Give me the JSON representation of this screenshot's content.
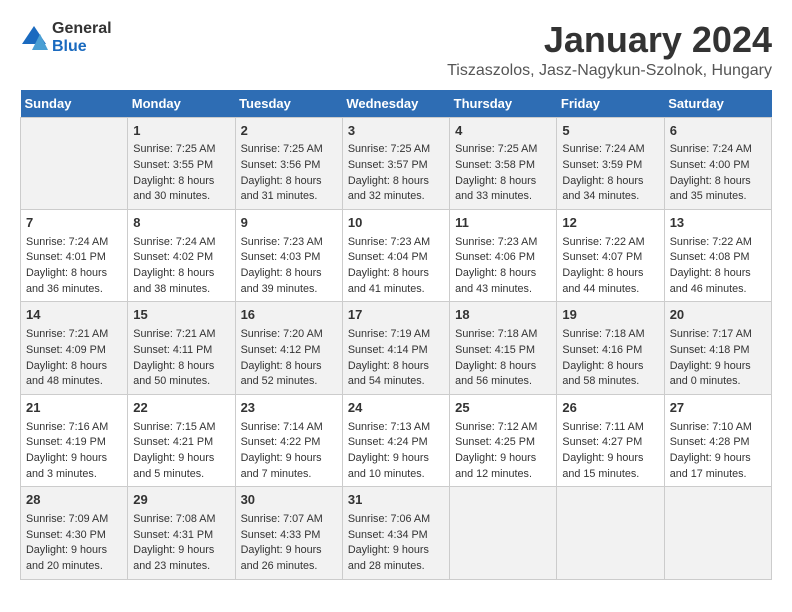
{
  "logo": {
    "general": "General",
    "blue": "Blue"
  },
  "header": {
    "title": "January 2024",
    "subtitle": "Tiszaszolos, Jasz-Nagykun-Szolnok, Hungary"
  },
  "days_of_week": [
    "Sunday",
    "Monday",
    "Tuesday",
    "Wednesday",
    "Thursday",
    "Friday",
    "Saturday"
  ],
  "weeks": [
    [
      {
        "day": "",
        "info": ""
      },
      {
        "day": "1",
        "info": "Sunrise: 7:25 AM\nSunset: 3:55 PM\nDaylight: 8 hours\nand 30 minutes."
      },
      {
        "day": "2",
        "info": "Sunrise: 7:25 AM\nSunset: 3:56 PM\nDaylight: 8 hours\nand 31 minutes."
      },
      {
        "day": "3",
        "info": "Sunrise: 7:25 AM\nSunset: 3:57 PM\nDaylight: 8 hours\nand 32 minutes."
      },
      {
        "day": "4",
        "info": "Sunrise: 7:25 AM\nSunset: 3:58 PM\nDaylight: 8 hours\nand 33 minutes."
      },
      {
        "day": "5",
        "info": "Sunrise: 7:24 AM\nSunset: 3:59 PM\nDaylight: 8 hours\nand 34 minutes."
      },
      {
        "day": "6",
        "info": "Sunrise: 7:24 AM\nSunset: 4:00 PM\nDaylight: 8 hours\nand 35 minutes."
      }
    ],
    [
      {
        "day": "7",
        "info": "Sunrise: 7:24 AM\nSunset: 4:01 PM\nDaylight: 8 hours\nand 36 minutes."
      },
      {
        "day": "8",
        "info": "Sunrise: 7:24 AM\nSunset: 4:02 PM\nDaylight: 8 hours\nand 38 minutes."
      },
      {
        "day": "9",
        "info": "Sunrise: 7:23 AM\nSunset: 4:03 PM\nDaylight: 8 hours\nand 39 minutes."
      },
      {
        "day": "10",
        "info": "Sunrise: 7:23 AM\nSunset: 4:04 PM\nDaylight: 8 hours\nand 41 minutes."
      },
      {
        "day": "11",
        "info": "Sunrise: 7:23 AM\nSunset: 4:06 PM\nDaylight: 8 hours\nand 43 minutes."
      },
      {
        "day": "12",
        "info": "Sunrise: 7:22 AM\nSunset: 4:07 PM\nDaylight: 8 hours\nand 44 minutes."
      },
      {
        "day": "13",
        "info": "Sunrise: 7:22 AM\nSunset: 4:08 PM\nDaylight: 8 hours\nand 46 minutes."
      }
    ],
    [
      {
        "day": "14",
        "info": "Sunrise: 7:21 AM\nSunset: 4:09 PM\nDaylight: 8 hours\nand 48 minutes."
      },
      {
        "day": "15",
        "info": "Sunrise: 7:21 AM\nSunset: 4:11 PM\nDaylight: 8 hours\nand 50 minutes."
      },
      {
        "day": "16",
        "info": "Sunrise: 7:20 AM\nSunset: 4:12 PM\nDaylight: 8 hours\nand 52 minutes."
      },
      {
        "day": "17",
        "info": "Sunrise: 7:19 AM\nSunset: 4:14 PM\nDaylight: 8 hours\nand 54 minutes."
      },
      {
        "day": "18",
        "info": "Sunrise: 7:18 AM\nSunset: 4:15 PM\nDaylight: 8 hours\nand 56 minutes."
      },
      {
        "day": "19",
        "info": "Sunrise: 7:18 AM\nSunset: 4:16 PM\nDaylight: 8 hours\nand 58 minutes."
      },
      {
        "day": "20",
        "info": "Sunrise: 7:17 AM\nSunset: 4:18 PM\nDaylight: 9 hours\nand 0 minutes."
      }
    ],
    [
      {
        "day": "21",
        "info": "Sunrise: 7:16 AM\nSunset: 4:19 PM\nDaylight: 9 hours\nand 3 minutes."
      },
      {
        "day": "22",
        "info": "Sunrise: 7:15 AM\nSunset: 4:21 PM\nDaylight: 9 hours\nand 5 minutes."
      },
      {
        "day": "23",
        "info": "Sunrise: 7:14 AM\nSunset: 4:22 PM\nDaylight: 9 hours\nand 7 minutes."
      },
      {
        "day": "24",
        "info": "Sunrise: 7:13 AM\nSunset: 4:24 PM\nDaylight: 9 hours\nand 10 minutes."
      },
      {
        "day": "25",
        "info": "Sunrise: 7:12 AM\nSunset: 4:25 PM\nDaylight: 9 hours\nand 12 minutes."
      },
      {
        "day": "26",
        "info": "Sunrise: 7:11 AM\nSunset: 4:27 PM\nDaylight: 9 hours\nand 15 minutes."
      },
      {
        "day": "27",
        "info": "Sunrise: 7:10 AM\nSunset: 4:28 PM\nDaylight: 9 hours\nand 17 minutes."
      }
    ],
    [
      {
        "day": "28",
        "info": "Sunrise: 7:09 AM\nSunset: 4:30 PM\nDaylight: 9 hours\nand 20 minutes."
      },
      {
        "day": "29",
        "info": "Sunrise: 7:08 AM\nSunset: 4:31 PM\nDaylight: 9 hours\nand 23 minutes."
      },
      {
        "day": "30",
        "info": "Sunrise: 7:07 AM\nSunset: 4:33 PM\nDaylight: 9 hours\nand 26 minutes."
      },
      {
        "day": "31",
        "info": "Sunrise: 7:06 AM\nSunset: 4:34 PM\nDaylight: 9 hours\nand 28 minutes."
      },
      {
        "day": "",
        "info": ""
      },
      {
        "day": "",
        "info": ""
      },
      {
        "day": "",
        "info": ""
      }
    ]
  ]
}
